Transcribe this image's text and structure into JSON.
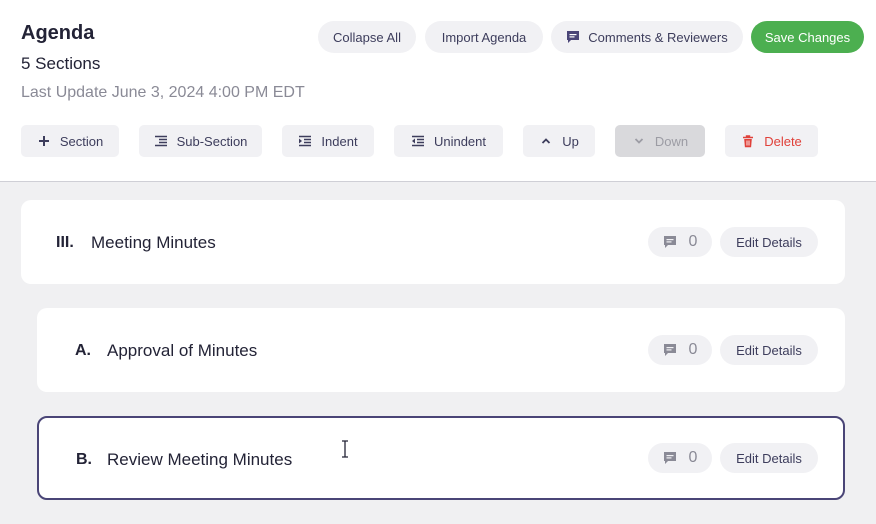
{
  "header": {
    "title": "Agenda",
    "subtitle": "5 Sections",
    "last_update": "Last Update June 3, 2024 4:00 PM EDT"
  },
  "actions": {
    "collapse_all": "Collapse All",
    "import_agenda": "Import Agenda",
    "comments_reviewers": "Comments & Reviewers",
    "save_changes": "Save Changes"
  },
  "toolbar": {
    "section": "Section",
    "sub_section": "Sub-Section",
    "indent": "Indent",
    "unindent": "Unindent",
    "up": "Up",
    "down": "Down",
    "delete": "Delete"
  },
  "items": [
    {
      "number": "III.",
      "title": "Meeting Minutes",
      "comments": "0",
      "edit_label": "Edit Details"
    },
    {
      "number": "A.",
      "title": "Approval of Minutes",
      "comments": "0",
      "edit_label": "Edit Details"
    },
    {
      "number": "B.",
      "title": "Review Meeting Minutes",
      "comments": "0",
      "edit_label": "Edit Details"
    }
  ],
  "colors": {
    "primary_green": "#4caf50",
    "delete_red": "#e0413a",
    "selected_border": "#4a4577"
  },
  "icons": [
    "plus-icon",
    "sub-section-icon",
    "indent-icon",
    "unindent-icon",
    "chevron-up-icon",
    "chevron-down-icon",
    "trash-icon",
    "comment-icon"
  ]
}
